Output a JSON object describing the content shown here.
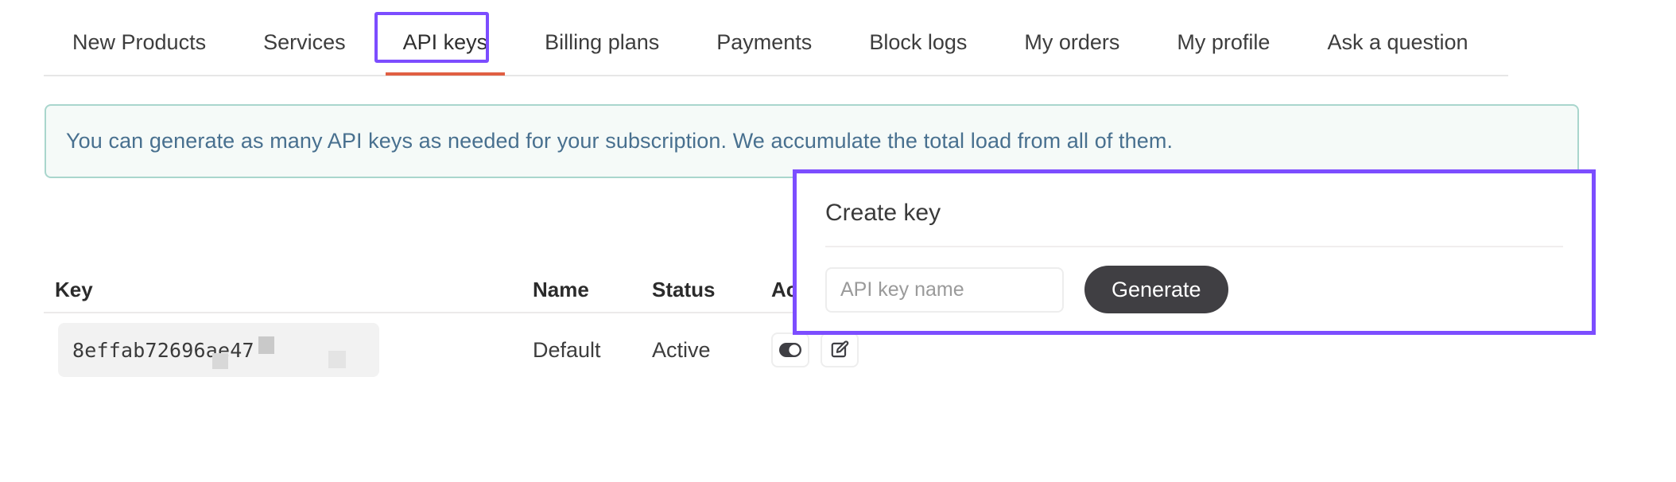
{
  "tabs": [
    {
      "label": "New Products",
      "active": false
    },
    {
      "label": "Services",
      "active": false
    },
    {
      "label": "API keys",
      "active": true
    },
    {
      "label": "Billing plans",
      "active": false
    },
    {
      "label": "Payments",
      "active": false
    },
    {
      "label": "Block logs",
      "active": false
    },
    {
      "label": "My orders",
      "active": false
    },
    {
      "label": "My profile",
      "active": false
    },
    {
      "label": "Ask a question",
      "active": false
    }
  ],
  "banner": {
    "text": "You can generate as many API keys as needed for your subscription. We accumulate the total load from all of them.",
    "border_color": "#a9d6cd",
    "background_color": "#f5faf8",
    "text_color": "#48708f"
  },
  "table": {
    "headers": {
      "key": "Key",
      "name": "Name",
      "status": "Status",
      "actions": "Actions"
    },
    "rows": [
      {
        "key": "8effab72696ae47",
        "name": "Default",
        "status": "Active",
        "actions": [
          "toggle-switch",
          "edit-pencil"
        ],
        "toggle_on": true
      }
    ]
  },
  "create_key": {
    "title": "Create key",
    "input_placeholder": "API key name",
    "input_value": "",
    "generate_label": "Generate",
    "highlight_color": "#7c4dff",
    "button_color": "#403f43"
  },
  "highlight": {
    "tab_ring_color": "#7c4dff",
    "active_tab_underline_color": "#e05f43"
  }
}
